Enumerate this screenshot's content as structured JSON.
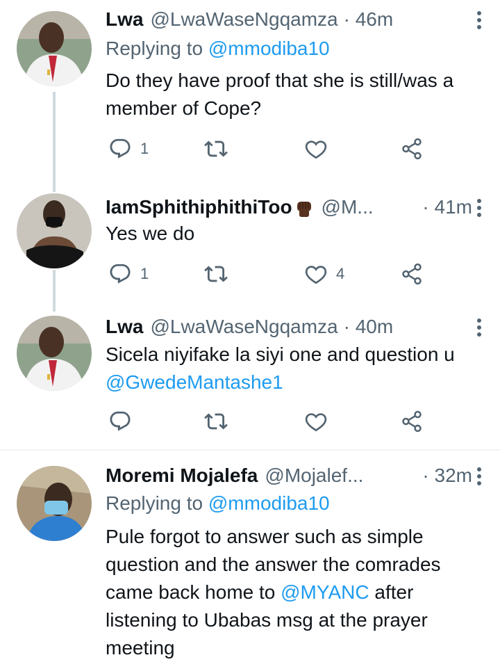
{
  "tweets": [
    {
      "name": "Lwa",
      "handle": "@LwaWaseNgqamza",
      "time": "· 46m",
      "replying_prefix": "Replying to",
      "replying_to": "@mmodiba10",
      "text": "Do they have proof that she is still/was a member of Cope?",
      "replies": "1",
      "retweets": "",
      "likes": ""
    },
    {
      "name": "IamSphithiphithiToo",
      "handle": "@M...",
      "time": "· 41m",
      "text": "Yes we do",
      "replies": "1",
      "retweets": "",
      "likes": "4"
    },
    {
      "name": "Lwa",
      "handle": "@LwaWaseNgqamza",
      "time": "· 40m",
      "text": "Sicela niyifake la siyi one and question u",
      "mention": "@GwedeMantashe1",
      "replies": "",
      "retweets": "",
      "likes": ""
    },
    {
      "name": "Moremi Mojalefa",
      "handle": "@Mojalef...",
      "time": "· 32m",
      "replying_prefix": "Replying to",
      "replying_to": "@mmodiba10",
      "text_before": "Pule forgot to answer such as simple question and the answer the comrades came back home to",
      "mention": "@MYANC",
      "text_after": "after listening to Ubabas msg at the prayer meeting"
    }
  ],
  "icons": [
    "reply-icon",
    "retweet-icon",
    "like-icon",
    "share-icon",
    "more-icon",
    "raised-fist-emoji"
  ],
  "colors": {
    "link": "#1d9bf0",
    "muted": "#536471",
    "thread_line": "#cfd9de"
  }
}
